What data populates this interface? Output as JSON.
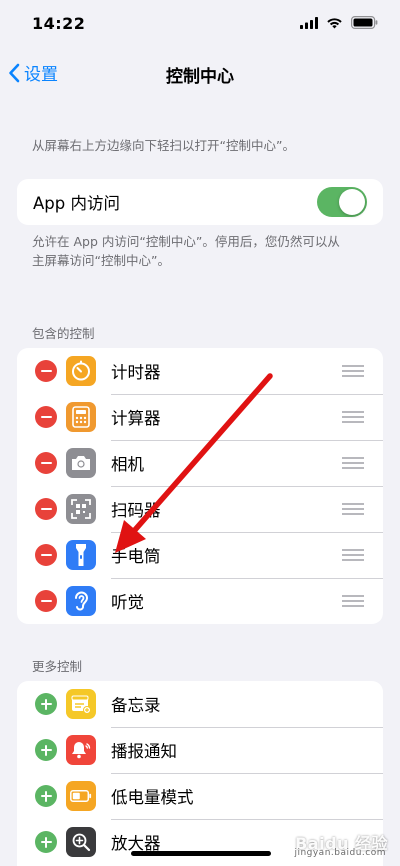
{
  "status_bar": {
    "time": "14:22"
  },
  "nav": {
    "back_label": "设置",
    "title": "控制中心"
  },
  "hint_top": "从屏幕右上方边缘向下轻扫以打开“控制中心”。",
  "app_access": {
    "label": "App 内访问",
    "enabled": true,
    "hint_line1": "允许在 App 内访问“控制中心”。停用后，您仍然可以从",
    "hint_line2": "主屏幕访问“控制中心”。"
  },
  "included_section": {
    "header": "包含的控制",
    "items": [
      {
        "label": "计时器",
        "icon": "timer-icon",
        "color": "#f5a623"
      },
      {
        "label": "计算器",
        "icon": "calculator-icon",
        "color": "#f0992f"
      },
      {
        "label": "相机",
        "icon": "camera-icon",
        "color": "#8e8e93"
      },
      {
        "label": "扫码器",
        "icon": "qr-code-scanner-icon",
        "color": "#8e8e93"
      },
      {
        "label": "手电筒",
        "icon": "flashlight-icon",
        "color": "#2f7cf6"
      },
      {
        "label": "听觉",
        "icon": "ear-icon",
        "color": "#2f7cf6"
      }
    ]
  },
  "more_section": {
    "header": "更多控制",
    "items": [
      {
        "label": "备忘录",
        "icon": "notes-icon",
        "color": "#f5c828"
      },
      {
        "label": "播报通知",
        "icon": "announce-notifications-icon",
        "color": "#f0453a"
      },
      {
        "label": "低电量模式",
        "icon": "battery-icon",
        "color": "#f5a623"
      },
      {
        "label": "放大器",
        "icon": "magnifier-icon",
        "color": "#3a3a3c"
      }
    ]
  },
  "annotation": {
    "color": "#e01212"
  },
  "watermark": {
    "brand": "Baidu 经验",
    "url": "jingyan.baidu.com"
  }
}
